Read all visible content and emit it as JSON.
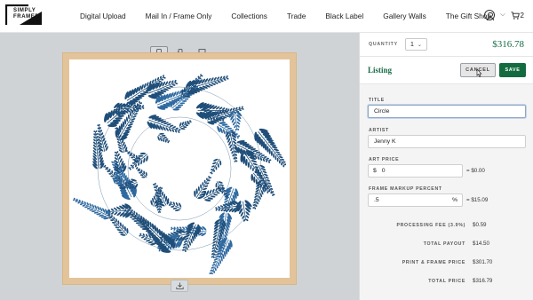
{
  "brand": {
    "name_line1": "SIMPLY",
    "name_line2": "FRAMED"
  },
  "nav": {
    "items": [
      {
        "label": "Digital Upload"
      },
      {
        "label": "Mail In / Frame Only"
      },
      {
        "label": "Collections"
      },
      {
        "label": "Trade"
      },
      {
        "label": "Black Label"
      },
      {
        "label": "Gallery Walls"
      },
      {
        "label": "The Gift Shop"
      }
    ]
  },
  "account": {
    "cart_count": "2"
  },
  "canvas": {
    "toolbar_icons": [
      "phone-portrait-icon",
      "phone-landscape-icon",
      "easel-icon"
    ],
    "download_icon": "download-icon",
    "colors": {
      "background": "#cfd3d6",
      "frame": "#e3c49a",
      "art_ink": "#1f4e79"
    }
  },
  "order": {
    "quantity_label": "QUANTITY",
    "quantity_value": "1",
    "price": "$316.78"
  },
  "listing": {
    "title": "Listing",
    "cancel_label": "CANCEL",
    "save_label": "SAVE"
  },
  "form": {
    "title_label": "TITLE",
    "title_value": "Circle",
    "artist_label": "ARTIST",
    "artist_value": "Jenny K",
    "art_price_label": "ART PRICE",
    "art_price_prefix": "$",
    "art_price_value": "0",
    "art_price_calc": "= $0.00",
    "markup_label": "FRAME MARKUP PERCENT",
    "markup_value": ".5",
    "markup_suffix": "%",
    "markup_calc": "= $15.09"
  },
  "summary": [
    {
      "label": "PROCESSING FEE (3.9%)",
      "value": "$0.59"
    },
    {
      "label": "TOTAL PAYOUT",
      "value": "$14.50"
    },
    {
      "label": "PRINT & FRAME PRICE",
      "value": "$301.70"
    },
    {
      "label": "TOTAL PRICE",
      "value": "$316.79"
    }
  ],
  "colors": {
    "accent_green": "#146b3f",
    "price_green": "#166b46"
  }
}
